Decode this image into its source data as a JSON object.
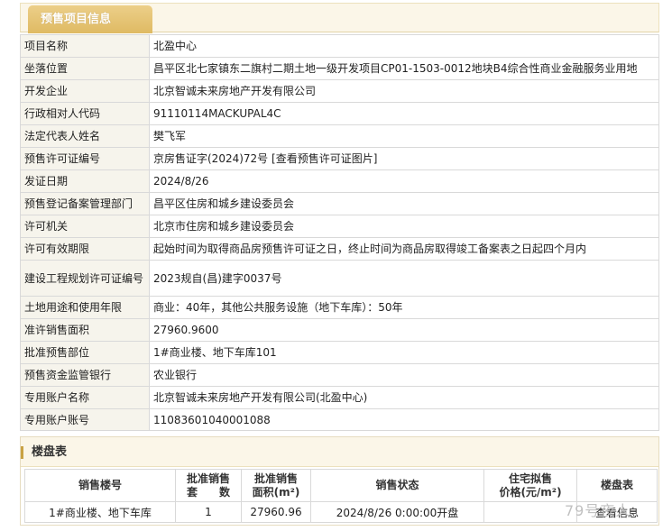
{
  "tab": {
    "title": "预售项目信息"
  },
  "info_rows": [
    {
      "label": "项目名称",
      "value": "北盈中心"
    },
    {
      "label": "坐落位置",
      "value": "昌平区北七家镇东二旗村二期土地一级开发项目CP01-1503-0012地块B4综合性商业金融服务业用地"
    },
    {
      "label": "开发企业",
      "value": "北京智诚未来房地产开发有限公司"
    },
    {
      "label": "行政相对人代码",
      "value": "91110114MACKUPAL4C"
    },
    {
      "label": "法定代表人姓名",
      "value": "樊飞军"
    },
    {
      "label": "预售许可证编号",
      "value": "京房售证字(2024)72号",
      "link": "[查看预售许可证图片]"
    },
    {
      "label": "发证日期",
      "value": "2024/8/26"
    },
    {
      "label": "预售登记备案管理部门",
      "value": "昌平区住房和城乡建设委员会"
    },
    {
      "label": "许可机关",
      "value": "北京市住房和城乡建设委员会"
    },
    {
      "label": "许可有效期限",
      "value": "起始时间为取得商品房预售许可证之日，终止时间为商品房取得竣工备案表之日起四个月内"
    },
    {
      "label": "建设工程规划许可证编号",
      "value": "2023规自(昌)建字0037号"
    },
    {
      "label": "土地用途和使用年限",
      "value": "商业：40年，其他公共服务设施（地下车库）：50年"
    },
    {
      "label": "准许销售面积",
      "value": "27960.9600"
    },
    {
      "label": "批准预售部位",
      "value": "1#商业楼、地下车库101"
    },
    {
      "label": "预售资金监管银行",
      "value": "农业银行"
    },
    {
      "label": "专用账户名称",
      "value": "北京智诚未来房地产开发有限公司(北盈中心)"
    },
    {
      "label": "专用账户账号",
      "value": "11083601040001088"
    }
  ],
  "building_table": {
    "title": "楼盘表",
    "headers": {
      "building": "销售楼号",
      "units_1": "批准销售",
      "units_2": "套　　数",
      "area_1": "批准销售",
      "area_2": "面积(m²)",
      "status": "销售状态",
      "price_1": "住宅拟售",
      "price_2": "价格(元/m²)",
      "table": "楼盘表"
    },
    "rows": [
      {
        "building": "1#商业楼、地下车库",
        "units": "1",
        "area": "27960.96",
        "status": "2024/8/26 0:00:00开盘",
        "price": "",
        "action": "查看信息"
      }
    ]
  },
  "watermark": "79号夜人"
}
